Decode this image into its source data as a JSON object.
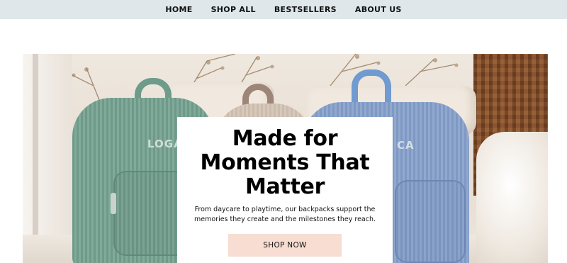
{
  "nav": {
    "items": [
      {
        "label": "HOME"
      },
      {
        "label": "SHOP ALL"
      },
      {
        "label": "BESTSELLERS"
      },
      {
        "label": "ABOUT US"
      }
    ]
  },
  "hero": {
    "image_alt_icons": {
      "green_bag_logo": "LOGA",
      "blue_bag_logo": "CA"
    },
    "title": "Made for Moments That Matter",
    "subtitle": "From daycare to playtime, our backpacks support the memories they create and the milestones they reach.",
    "cta_label": "SHOP NOW"
  },
  "colors": {
    "nav_bg": "#dfe7ea",
    "cta_bg": "#f7ddd2",
    "green_bag": "#7ba594",
    "blue_bag": "#8aa3cc"
  }
}
